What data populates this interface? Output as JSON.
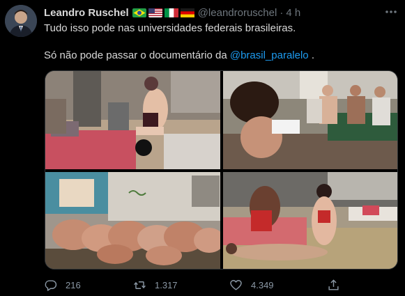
{
  "tweet": {
    "display_name": "Leandro Ruschel",
    "flags": [
      "brazil-flag-icon",
      "usa-flag-icon",
      "italy-flag-icon",
      "germany-flag-icon"
    ],
    "handle": "@leandroruschel",
    "separator": "·",
    "time": "4 h",
    "text_line1": "Tudo isso pode nas universidades federais brasileiras.",
    "text_line2_prefix": "Só não pode passar o documentário da ",
    "mention": "@brasil_paralelo",
    "text_line2_suffix": " .",
    "actions": {
      "replies": "216",
      "retweets": "1.317",
      "likes": "4.349"
    }
  },
  "colors": {
    "background": "#000000",
    "text": "#d9d9d9",
    "muted": "#6e767d",
    "link": "#1d9bf0",
    "action_icon": "#8b98a5"
  },
  "icons": {
    "more": "more-dots-icon",
    "reply": "reply-icon",
    "retweet": "retweet-icon",
    "like": "heart-icon",
    "share": "share-icon"
  }
}
